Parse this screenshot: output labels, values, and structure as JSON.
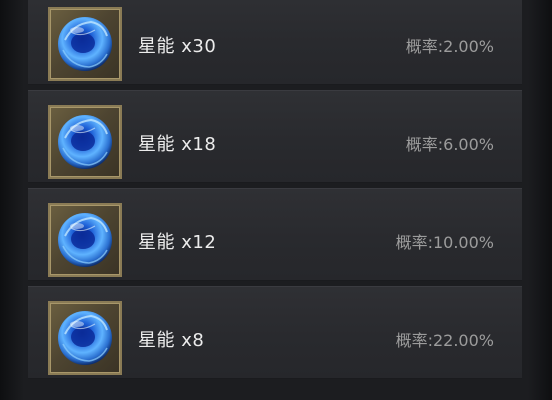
{
  "reward_list": {
    "items": [
      {
        "icon": "star-energy-orb-icon",
        "name": "星能 x30",
        "probability": "概率:2.00%"
      },
      {
        "icon": "star-energy-orb-icon",
        "name": "星能 x18",
        "probability": "概率:6.00%"
      },
      {
        "icon": "star-energy-orb-icon",
        "name": "星能 x12",
        "probability": "概率:10.00%"
      },
      {
        "icon": "star-energy-orb-icon",
        "name": "星能 x8",
        "probability": "概率:22.00%"
      }
    ]
  },
  "colors": {
    "row_background": "#2c2d31",
    "icon_frame": "#8a7b55",
    "orb_blue": "#2f7fe0",
    "name_text": "#ececec",
    "probability_text": "#9c9c9c"
  }
}
